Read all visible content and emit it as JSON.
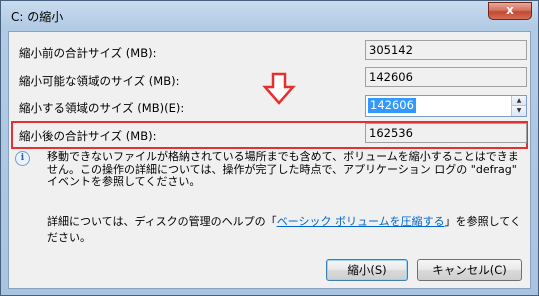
{
  "window": {
    "title": "C: の縮小",
    "close_label": "x"
  },
  "rows": [
    {
      "label": "縮小前の合計サイズ (MB):",
      "value": "305142"
    },
    {
      "label": "縮小可能な領域のサイズ (MB):",
      "value": "142606"
    },
    {
      "label": "縮小する領域のサイズ (MB)(E):",
      "value": "142606"
    },
    {
      "label": "縮小後の合計サイズ (MB):",
      "value": "162536"
    }
  ],
  "info": {
    "icon": "info-icon",
    "text": "移動できないファイルが格納されている場所までも含めて、ボリュームを縮小することはできません。この操作の詳細については、操作が完了した時点で、アプリケーション ログの \"defrag\" イベントを参照してください。"
  },
  "help": {
    "prefix": "詳細については、ディスクの管理のヘルプの「",
    "link": "ベーシック ボリュームを圧縮する",
    "suffix": "」を参照してください。"
  },
  "buttons": {
    "shrink": "縮小(S)",
    "cancel": "キャンセル(C)"
  },
  "annotation": {
    "highlight_color": "#e53030",
    "arrow_icon": "down-arrow-icon"
  }
}
